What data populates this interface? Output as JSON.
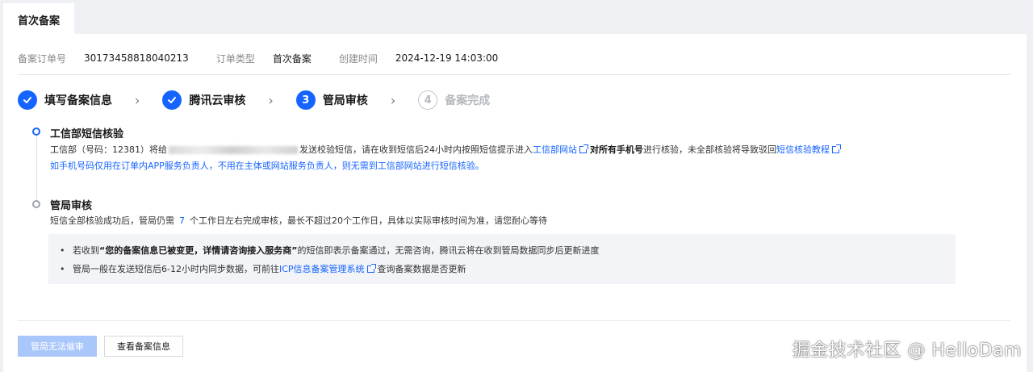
{
  "tab": {
    "label": "首次备案"
  },
  "info": {
    "order_no_label": "备案订单号",
    "order_no_value": "301734588180402​13",
    "order_type_label": "订单类型",
    "order_type_value": "首次备案",
    "created_label": "创建时间",
    "created_value": "2024-12-19 14:03:00"
  },
  "steps": [
    {
      "label": "填写备案信息",
      "state": "done",
      "num": ""
    },
    {
      "label": "腾讯云审核",
      "state": "done",
      "num": ""
    },
    {
      "label": "管局审核",
      "state": "active",
      "num": "3"
    },
    {
      "label": "备案完成",
      "state": "pending",
      "num": "4"
    }
  ],
  "section1": {
    "title": "工信部短信核验",
    "line1_a": "工信部（号码：12381）将给",
    "line1_b": "发送校验短信，请在收到短信后24小时内按照短信提示进入",
    "line1_link1": "工信部网站",
    "line1_c": "对所有手机号",
    "line1_d": "进行核验，未全部核验将导致驳回",
    "line1_link2": "短信核验教程",
    "line2": "如手机号码仅用在订单内APP服务负责人，不用在主体或网站服务负责人，则无需到工信部网站进行短信核验。"
  },
  "section2": {
    "title": "管局审核",
    "text_a": "短信全部核验成功后，管局仍需",
    "days": "7",
    "text_b": "个工作日左右完成审核，最长不超过20个工作日，具体以实际审核时间为准，请您耐心等待"
  },
  "notice": {
    "item1_a": "若收到",
    "item1_strong": "“您的备案信息已被变更，详情请咨询接入服务商”",
    "item1_b": "的短信即表示备案通过，无需咨询，腾讯云将在收到管局数据同步后更新进度",
    "item2_a": "管局一般在发送短信后6-12小时内同步数据，可前往",
    "item2_link": "ICP信息备案管理系统",
    "item2_b": "查询备案数据是否更新"
  },
  "buttons": {
    "urge": "管局无法催审",
    "view": "查看备案信息"
  },
  "watermark": "掘金技术社区 @ HelloDam"
}
